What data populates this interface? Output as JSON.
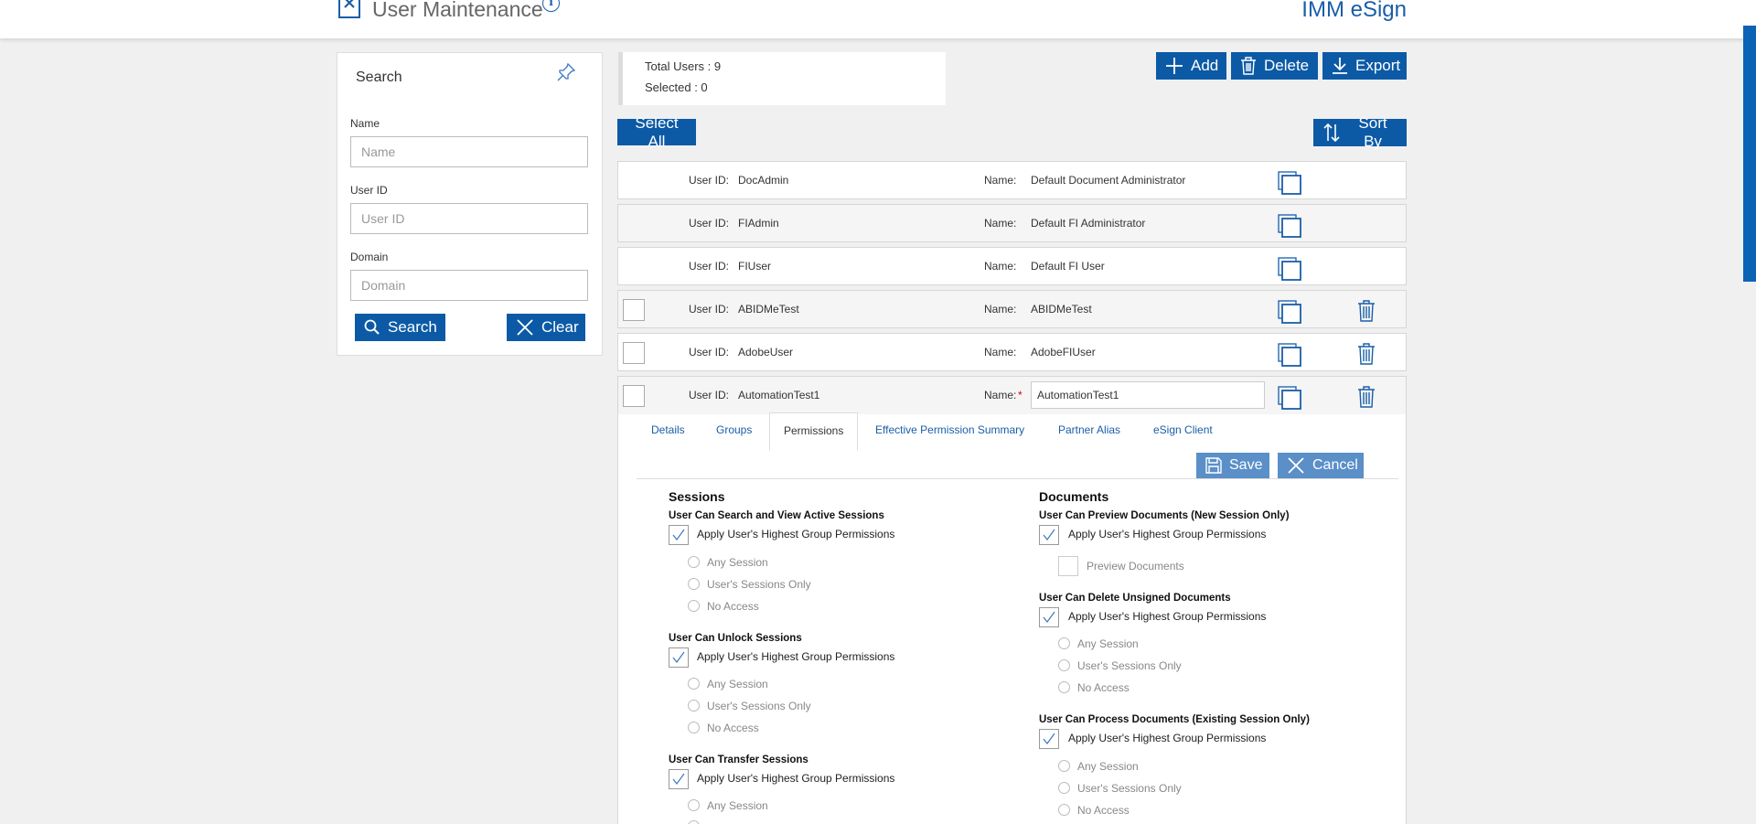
{
  "header": {
    "title": "User Maintenance",
    "brand": "IMM eSign"
  },
  "search": {
    "title": "Search",
    "name_label": "Name",
    "name_placeholder": "Name",
    "userid_label": "User ID",
    "userid_placeholder": "User ID",
    "domain_label": "Domain",
    "domain_placeholder": "Domain",
    "search_button": "Search",
    "clear_button": "Clear"
  },
  "summary": {
    "total": "Total Users : 9",
    "selected": "Selected : 0"
  },
  "toolbar": {
    "add": "Add",
    "delete": "Delete",
    "export": "Export",
    "select_all": "Select All",
    "sort_by": "Sort By"
  },
  "labels": {
    "user_id": "User ID:",
    "name": "Name:",
    "required_mark": "*"
  },
  "users": [
    {
      "user_id": "DocAdmin",
      "name": "Default Document Administrator"
    },
    {
      "user_id": "FIAdmin",
      "name": "Default FI Administrator"
    },
    {
      "user_id": "FIUser",
      "name": "Default FI User"
    },
    {
      "user_id": "ABIDMeTest",
      "name": "ABIDMeTest"
    },
    {
      "user_id": "AdobeUser",
      "name": "AdobeFIUser"
    },
    {
      "user_id": "AutomationTest1",
      "name": "AutomationTest1"
    }
  ],
  "tabs": [
    "Details",
    "Groups",
    "Permissions",
    "Effective Permission Summary",
    "Partner Alias",
    "eSign Client"
  ],
  "active_tab": "Permissions",
  "edit_actions": {
    "save": "Save",
    "cancel": "Cancel"
  },
  "permissions": {
    "apply_label": "Apply User's Highest Group Permissions",
    "options": [
      "Any Session",
      "User's Sessions Only",
      "No Access"
    ],
    "sessions": {
      "title": "Sessions",
      "items": [
        "User Can Search and View Active Sessions",
        "User Can Unlock Sessions",
        "User Can Transfer Sessions"
      ]
    },
    "documents": {
      "title": "Documents",
      "items": [
        "User Can Preview Documents (New Session Only)",
        "User Can Delete Unsigned Documents",
        "User Can Process Documents (Existing Session Only)"
      ],
      "preview_label": "Preview Documents"
    }
  },
  "colors": {
    "primary": "#0c5aa6",
    "link": "#1a5ea8",
    "background": "#f0f0f0"
  }
}
